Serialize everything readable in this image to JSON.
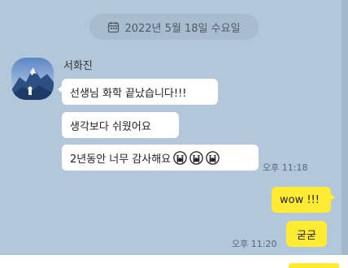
{
  "date_divider": {
    "text": "2022년 5월 18일 수요일",
    "icon": "calendar-icon"
  },
  "incoming": {
    "sender_name": "서화진",
    "avatar_icon": "mountain-avatar",
    "messages": [
      {
        "text": "선생님 화학 끝났습니다!!!"
      },
      {
        "text": "생각보다 쉬웠어요"
      },
      {
        "text": "2년동안 너무 감사해요",
        "emoji": [
          "crying-face",
          "crying-face",
          "crying-face"
        ]
      }
    ],
    "time": "오후 11:18"
  },
  "outgoing": {
    "messages": [
      {
        "text": "wow !!!"
      },
      {
        "text": "굳굳"
      }
    ],
    "time": "오후 11:20"
  },
  "colors": {
    "background": "#b2c7d9",
    "incoming_bubble": "#ffffff",
    "outgoing_bubble": "#ffeb33"
  }
}
